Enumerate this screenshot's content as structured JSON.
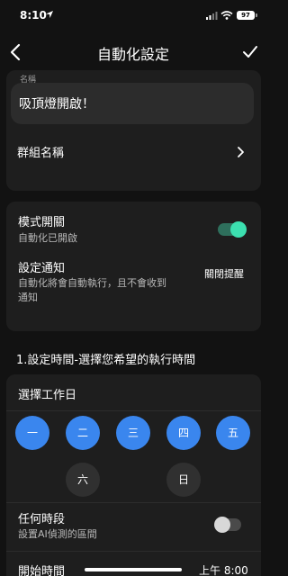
{
  "status_bar": {
    "time": "8:10",
    "battery": "97"
  },
  "nav": {
    "title": "自動化設定"
  },
  "name_field": {
    "label": "名稱",
    "value": "吸頂燈開啟！"
  },
  "group": {
    "label": "群組名稱"
  },
  "mode": {
    "title": "模式開關",
    "subtitle": "自動化已開啟",
    "enabled": true
  },
  "notify": {
    "title": "設定通知",
    "subtitle_line1": "自動化將會自動執行，且不會收到",
    "subtitle_line2": "通知",
    "value": "關閉提醒"
  },
  "section": {
    "heading": "1.設定時間-選擇您希望的執行時間"
  },
  "workdays": {
    "title": "選擇工作日",
    "days": [
      {
        "label": "一",
        "selected": true
      },
      {
        "label": "二",
        "selected": true
      },
      {
        "label": "三",
        "selected": true
      },
      {
        "label": "四",
        "selected": true
      },
      {
        "label": "五",
        "selected": true
      },
      {
        "label": "六",
        "selected": false
      },
      {
        "label": "日",
        "selected": false
      }
    ]
  },
  "any_time": {
    "title": "任何時段",
    "subtitle": "設置AI偵測的區間",
    "enabled": false
  },
  "start_time": {
    "title": "開始時間",
    "value": "上午 8:00"
  },
  "colors": {
    "accent_blue": "#3a86ee",
    "toggle_green": "#3ce0b0",
    "card_bg": "#1e1e1e",
    "page_bg": "#121212"
  }
}
